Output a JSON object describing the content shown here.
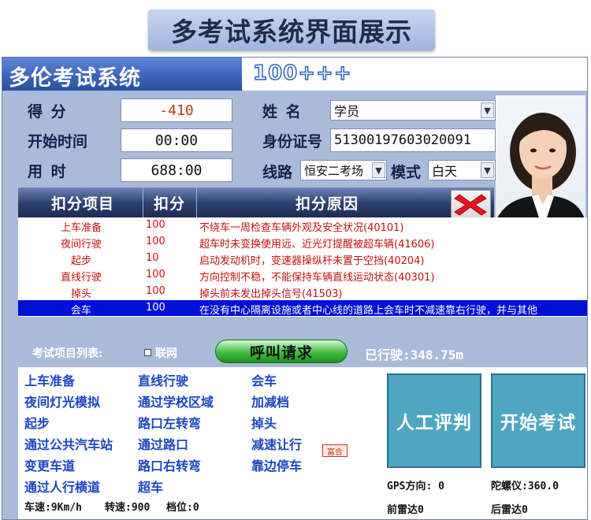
{
  "banner_title": "多考试系统界面展示",
  "app": {
    "title": "多伦考试系统",
    "code": "100+++"
  },
  "info": {
    "score_label": "得  分",
    "score_value": "-410",
    "start_label": "开始时间",
    "start_value": "00:00",
    "duration_label": "用  时",
    "duration_value": "688:00",
    "name_label": "姓  名",
    "name_value": "学员",
    "id_label": "身份证号",
    "id_value": "513001976030200 91",
    "route_label": "线路",
    "route_value": "恒安二考场",
    "mode_label": "模式",
    "mode_value": "白天"
  },
  "table": {
    "headers": [
      "扣分项目",
      "扣分",
      "扣分原因"
    ],
    "rows": [
      {
        "item": "上车准备",
        "points": "100",
        "reason": "不绕车一周检查车辆外观及安全状况(40101)"
      },
      {
        "item": "夜间行驶",
        "points": "100",
        "reason": "超车时未变换使用远、近光灯提醒被超车辆(41606)"
      },
      {
        "item": "起步",
        "points": "10",
        "reason": "启动发动机时，变速器操纵杆未置于空挡(40204)"
      },
      {
        "item": "直线行驶",
        "points": "100",
        "reason": "方向控制不稳，不能保持车辆直线运动状态(40301)"
      },
      {
        "item": "掉头",
        "points": "100",
        "reason": "掉头前未发出掉头信号(41503)"
      },
      {
        "item": "会车",
        "points": "100",
        "reason": "在没有中心隔离设施或者中心线的道路上会车时不减速靠右行驶，并与其他"
      }
    ]
  },
  "list_bar": {
    "label": "考试项目列表:",
    "net_label": "联网",
    "call_button": "呼叫请求",
    "distance": "已行驶:348.75m"
  },
  "items": {
    "col1": [
      "上车准备",
      "夜间灯光模拟",
      "起步",
      "通过公共汽车站",
      "变更车道",
      "通过人行横道"
    ],
    "col2": [
      "直线行驶",
      "通过学校区域",
      "路口左转弯",
      "通过路口",
      "路口右转弯",
      "超车"
    ],
    "col3": [
      "会车",
      "加减档",
      "掉头",
      "减速让行",
      "靠边停车"
    ],
    "small_button": "富合"
  },
  "buttons": {
    "manual": "人工评判",
    "start": "开始考试"
  },
  "status": {
    "speed": "车速:9Km/h",
    "rpm": "转速:900",
    "gear": "档位:0",
    "gps": "GPS方向: 0",
    "gyro": "陀螺仪:360.0",
    "front_radar": "前雷达0",
    "rear_radar": "后雷达0"
  },
  "colors": {
    "title_bar": "#3a62b8",
    "table_text": "#c4120f",
    "selected_row": "#0010d8",
    "item_link": "#1c45c4",
    "action_button": "#4fa6c3",
    "call_button": "#3fbe3f"
  }
}
